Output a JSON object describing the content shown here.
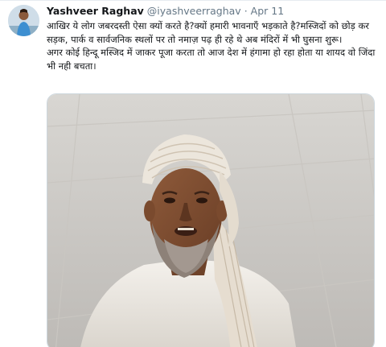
{
  "tweet": {
    "author_name": "Yashveer Raghav",
    "handle": "@iyashveerraghav",
    "separator": "·",
    "date": "Apr 11",
    "paragraph_1": "आखिर ये लोग जबरदस्ती ऐसा क्यों करते है?क्यों हमारी भावनाएँ भड़काते है?मस्जिदों को छोड़ कर सड़क, पार्क व सार्वजनिक स्थलों पर तो नमाज़ पढ़ ही रहे थे अब मंदिरों में भी घुसना शुरू।",
    "paragraph_2": "अगर कोई हिन्दू मस्जिद में जाकर पूजा करता तो आज देश में हंगामा हो रहा होता या शायद वो जिंदा भी नही बचता।"
  },
  "colors": {
    "name": "#14171a",
    "meta": "#657786",
    "border": "#e6ecf0"
  }
}
